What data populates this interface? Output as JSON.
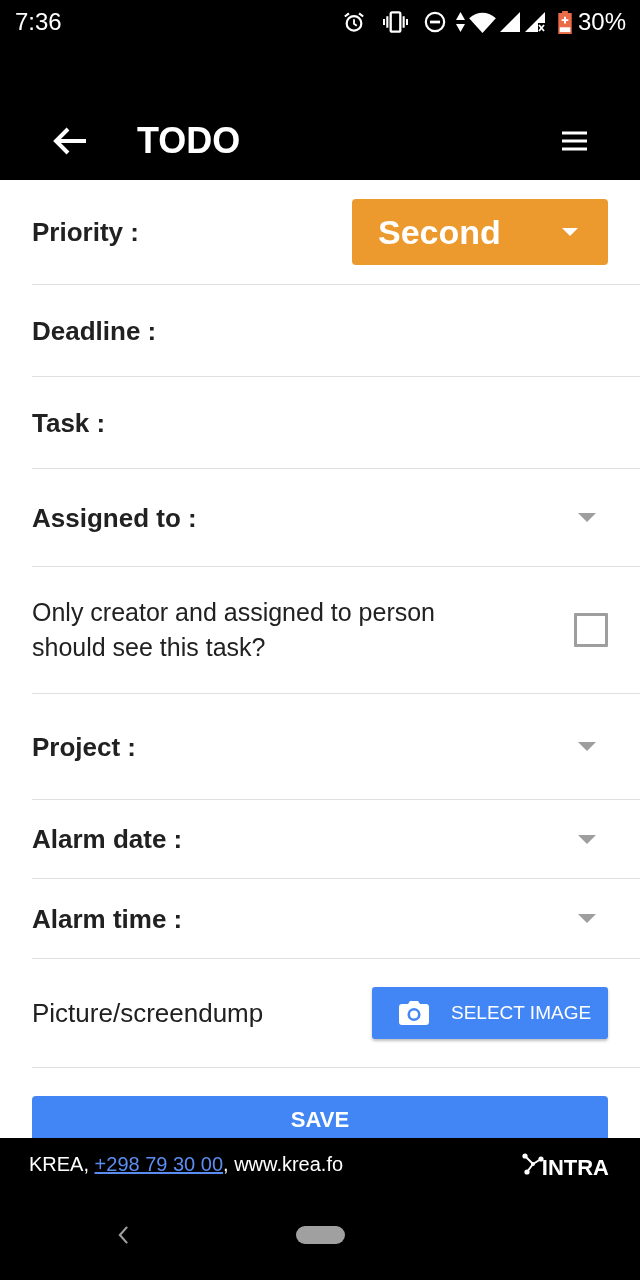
{
  "status_bar": {
    "time": "7:36",
    "battery": "30%"
  },
  "app_bar": {
    "title": "TODO"
  },
  "form": {
    "fields": [
      {
        "kind": "priority",
        "label": "Priority :",
        "value": "Second"
      },
      {
        "kind": "text",
        "label": "Deadline :"
      },
      {
        "kind": "text",
        "label": "Task :"
      },
      {
        "kind": "dropdown",
        "label": "Assigned to :"
      },
      {
        "kind": "checkbox",
        "label": "Only creator and assigned to person should see this task?",
        "checked": false
      },
      {
        "kind": "dropdown",
        "label": "Project :"
      },
      {
        "kind": "dropdown",
        "label": "Alarm date :"
      },
      {
        "kind": "dropdown",
        "label": "Alarm time :"
      },
      {
        "kind": "image",
        "label": "Picture/screendump",
        "button": "SELECT IMAGE"
      }
    ],
    "save_button": "SAVE"
  },
  "footer": {
    "prefix": "KREA, ",
    "phone": "+298 79 30 00",
    "suffix": ", www.krea.fo",
    "logo": "INTRA"
  }
}
